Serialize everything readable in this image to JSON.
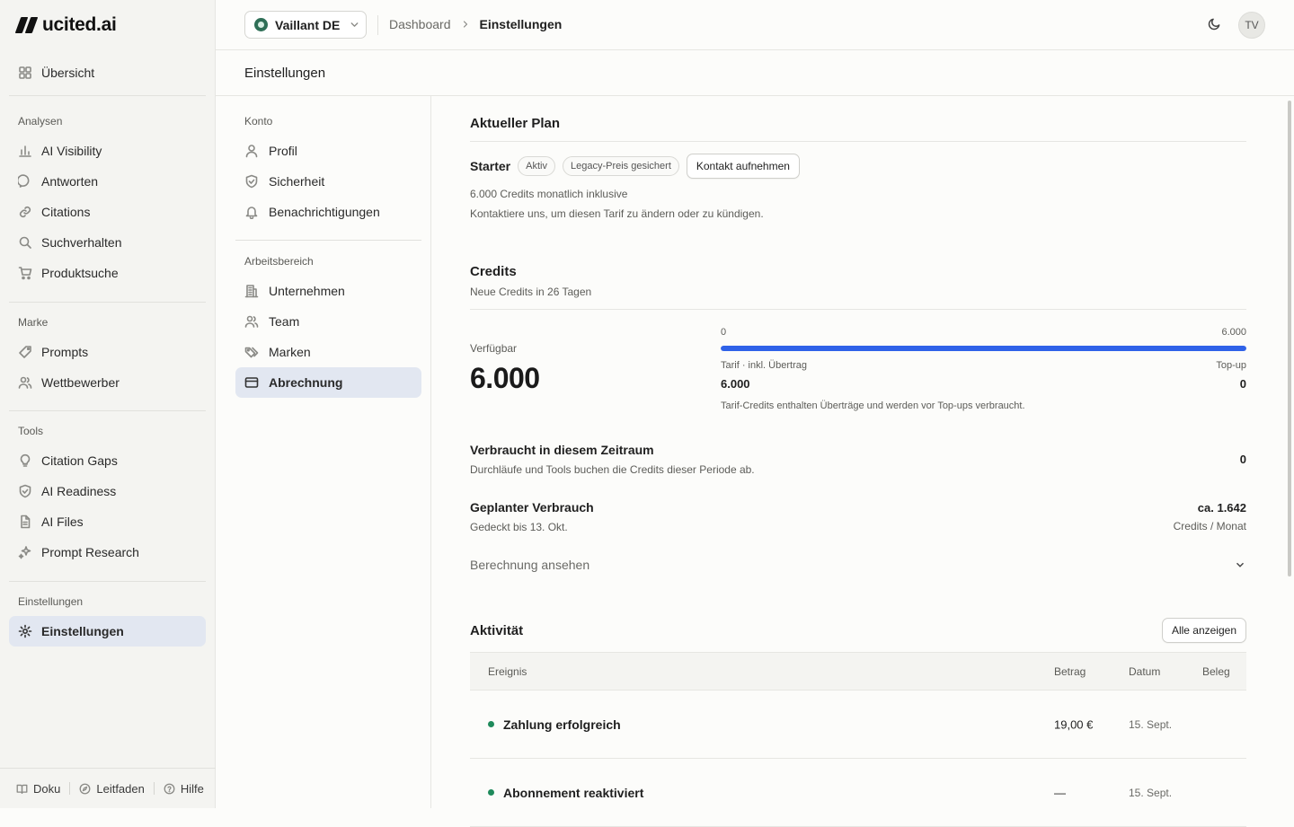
{
  "app": {
    "logo_text": "ucited.ai"
  },
  "sidebar": {
    "overview": "Übersicht",
    "sections": [
      {
        "label": "Analysen",
        "items": [
          "AI Visibility",
          "Antworten",
          "Citations",
          "Suchverhalten",
          "Produktsuche"
        ]
      },
      {
        "label": "Marke",
        "items": [
          "Prompts",
          "Wettbewerber"
        ]
      },
      {
        "label": "Tools",
        "items": [
          "Citation Gaps",
          "AI Readiness",
          "AI Files",
          "Prompt Research"
        ]
      },
      {
        "label": "Einstellungen",
        "items": [
          "Einstellungen"
        ]
      }
    ],
    "footer": {
      "docs": "Doku",
      "guide": "Leitfaden",
      "help": "Hilfe"
    }
  },
  "topbar": {
    "workspace": "Vaillant DE",
    "breadcrumb": {
      "parent": "Dashboard",
      "current": "Einstellungen"
    },
    "avatar_initials": "TV"
  },
  "page_title": "Einstellungen",
  "settings_nav": {
    "account_label": "Konto",
    "account_items": [
      "Profil",
      "Sicherheit",
      "Benachrichtigungen"
    ],
    "workspace_label": "Arbeitsbereich",
    "workspace_items": [
      "Unternehmen",
      "Team",
      "Marken",
      "Abrechnung"
    ]
  },
  "plan": {
    "heading": "Aktueller Plan",
    "name": "Starter",
    "badge_status": "Aktiv",
    "badge_legacy": "Legacy-Preis gesichert",
    "contact_button": "Kontakt aufnehmen",
    "credits_info": "6.000 Credits monatlich inklusive",
    "contact_hint": "Kontaktiere uns, um diesen Tarif zu ändern oder zu kündigen."
  },
  "credits": {
    "heading": "Credits",
    "renewal": "Neue Credits in 26 Tagen",
    "available_label": "Verfügbar",
    "available_value": "6.000",
    "bar_min": "0",
    "bar_max": "6.000",
    "bar_fill_fraction": 1.0,
    "plan_label": "Tarif · inkl. Übertrag",
    "plan_value": "6.000",
    "topup_label": "Top-up",
    "topup_value": "0",
    "note": "Tarif-Credits enthalten Überträge und werden vor Top-ups verbraucht.",
    "used_title": "Verbraucht in diesem Zeitraum",
    "used_desc": "Durchläufe und Tools buchen die Credits dieser Periode ab.",
    "used_value": "0",
    "planned_title": "Geplanter Verbrauch",
    "planned_desc": "Gedeckt bis 13. Okt.",
    "planned_value": "ca. 1.642",
    "planned_unit": "Credits / Monat",
    "calc_link": "Berechnung ansehen"
  },
  "activity": {
    "heading": "Aktivität",
    "show_all": "Alle anzeigen",
    "columns": [
      "Ereignis",
      "Betrag",
      "Datum",
      "Beleg"
    ],
    "rows": [
      {
        "event": "Zahlung erfolgreich",
        "amount": "19,00 €",
        "date": "15. Sept."
      },
      {
        "event": "Abonnement reaktiviert",
        "amount": "—",
        "date": "15. Sept."
      }
    ]
  },
  "colors": {
    "accent": "#2f62e8",
    "active_bg": "#e2e7f1",
    "success": "#1f8a5b"
  }
}
